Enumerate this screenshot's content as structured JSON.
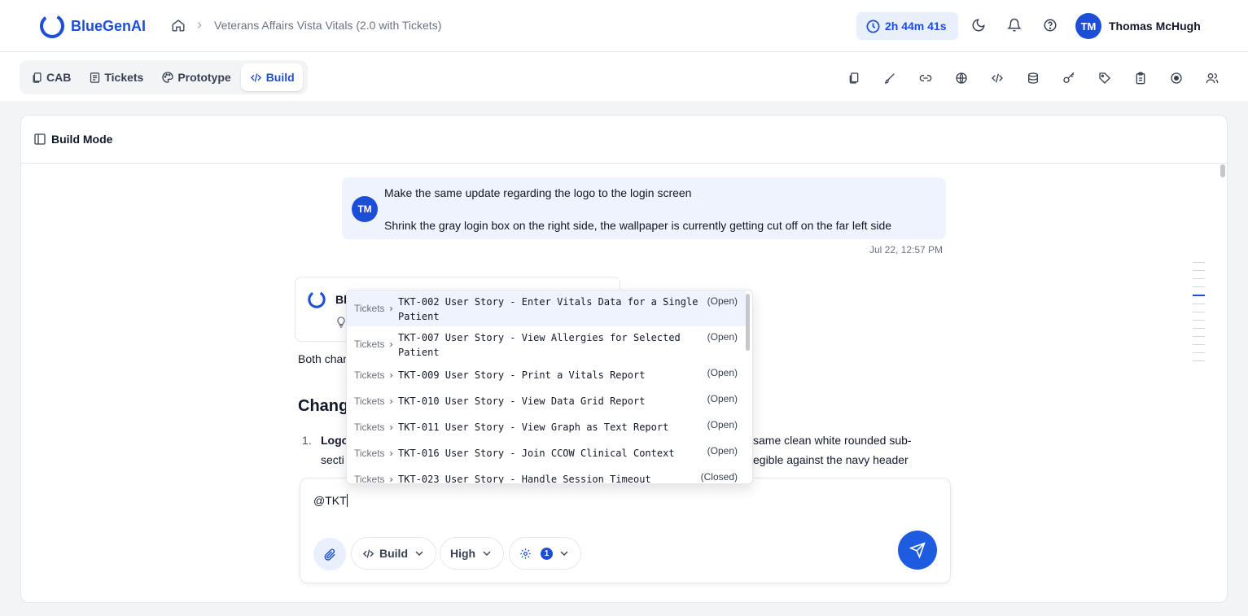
{
  "header": {
    "brand": "BlueGenAI",
    "project_title": "Veterans Affairs Vista Vitals (2.0 with Tickets)",
    "timer": "2h 44m 41s",
    "user_initials": "TM",
    "user_name": "Thomas McHugh"
  },
  "tabs": [
    {
      "label": "CAB",
      "icon": "document-icon"
    },
    {
      "label": "Tickets",
      "icon": "list-icon"
    },
    {
      "label": "Prototype",
      "icon": "palette-icon"
    },
    {
      "label": "Build",
      "icon": "code-icon",
      "active": true
    }
  ],
  "toolbar_icons": [
    "files-icon",
    "brush-icon",
    "link-icon",
    "globe-icon",
    "code-icon",
    "database-icon",
    "key-icon",
    "tag-icon",
    "clipboard-icon",
    "record-icon",
    "users-icon"
  ],
  "panel": {
    "title": "Build Mode"
  },
  "conversation": {
    "user_message": {
      "initials": "TM",
      "line1": "Make the same update regarding the logo to the login screen",
      "line2": "Shrink the gray login box on the right side, the wallpaper is currently getting cut off on the far left side",
      "time": "Jul 22, 12:57 PM"
    },
    "ai": {
      "name_partial": "Bl",
      "intro_partial": "Both chan",
      "heading_partial": "Chang",
      "list_number": "1.",
      "item_bold_partial": "Logo",
      "item_line1_right": "same clean white rounded sub-",
      "item_line2_left": "secti",
      "item_line2_right": "egible against the navy header"
    }
  },
  "composer": {
    "input_value": "@TKT",
    "mode_label": "Build",
    "effort_label": "High",
    "settings_count": "1"
  },
  "dropdown": {
    "options": [
      {
        "source": "Tickets",
        "title": "TKT-002 User Story - Enter Vitals Data for a Single Patient",
        "status": "(Open)"
      },
      {
        "source": "Tickets",
        "title": "TKT-007 User Story - View Allergies for Selected Patient",
        "status": "(Open)"
      },
      {
        "source": "Tickets",
        "title": "TKT-009 User Story - Print a Vitals Report",
        "status": "(Open)"
      },
      {
        "source": "Tickets",
        "title": "TKT-010 User Story - View Data Grid Report",
        "status": "(Open)"
      },
      {
        "source": "Tickets",
        "title": "TKT-011 User Story - View Graph as Text Report",
        "status": "(Open)"
      },
      {
        "source": "Tickets",
        "title": "TKT-016 User Story - Join CCOW Clinical Context",
        "status": "(Open)"
      },
      {
        "source": "Tickets",
        "title": "TKT-023 User Story - Handle Session Timeout",
        "status": "(Closed)"
      }
    ]
  },
  "colors": {
    "accent": "#1d4ed8",
    "user_bubble": "#eef3fd",
    "highlight": "#eef3fd"
  }
}
